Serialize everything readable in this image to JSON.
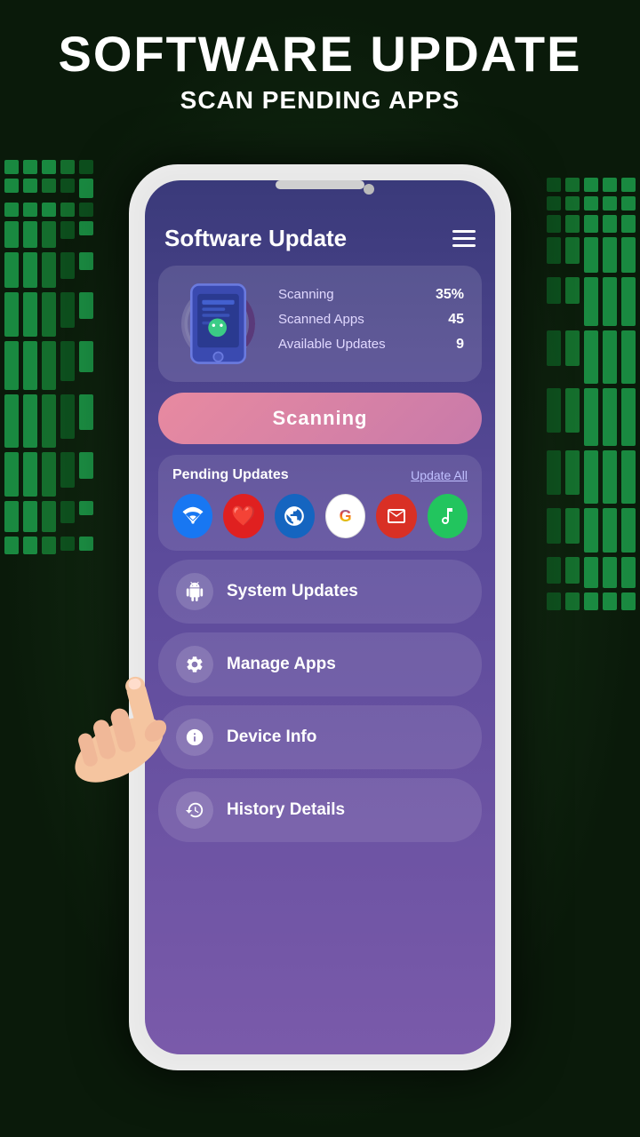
{
  "background": {
    "color": "#0a1a0a"
  },
  "header": {
    "main_title": "SOFTWARE UPDATE",
    "sub_title": "SCAN PENDING APPS"
  },
  "app": {
    "title": "Software Update",
    "menu_icon_label": "menu",
    "scan_card": {
      "scanning_label": "Scanning",
      "scanning_value": "35%",
      "scanned_apps_label": "Scanned Apps",
      "scanned_apps_value": "45",
      "available_updates_label": "Available Updates",
      "available_updates_value": "9",
      "progress_percent": 35
    },
    "scan_button_label": "Scanning",
    "pending_updates": {
      "title": "Pending Updates",
      "update_all_label": "Update All",
      "apps": [
        {
          "name": "wifi",
          "color": "#1877f2",
          "icon": "📶"
        },
        {
          "name": "heart",
          "color": "#e02020",
          "icon": "❤️"
        },
        {
          "name": "globe",
          "color": "#1565c0",
          "icon": "🌐"
        },
        {
          "name": "google",
          "color": "#ea4335",
          "icon": "G"
        },
        {
          "name": "gmail",
          "color": "#d93025",
          "icon": "✉"
        },
        {
          "name": "music",
          "color": "#22c55e",
          "icon": "🎵"
        }
      ]
    },
    "menu_items": [
      {
        "id": "system-updates",
        "label": "System Updates",
        "icon": "android"
      },
      {
        "id": "manage-apps",
        "label": "Manage Apps",
        "icon": "gear"
      },
      {
        "id": "device-info",
        "label": "Device Info",
        "icon": "info"
      },
      {
        "id": "history-details",
        "label": "History Details",
        "icon": "history"
      }
    ]
  }
}
